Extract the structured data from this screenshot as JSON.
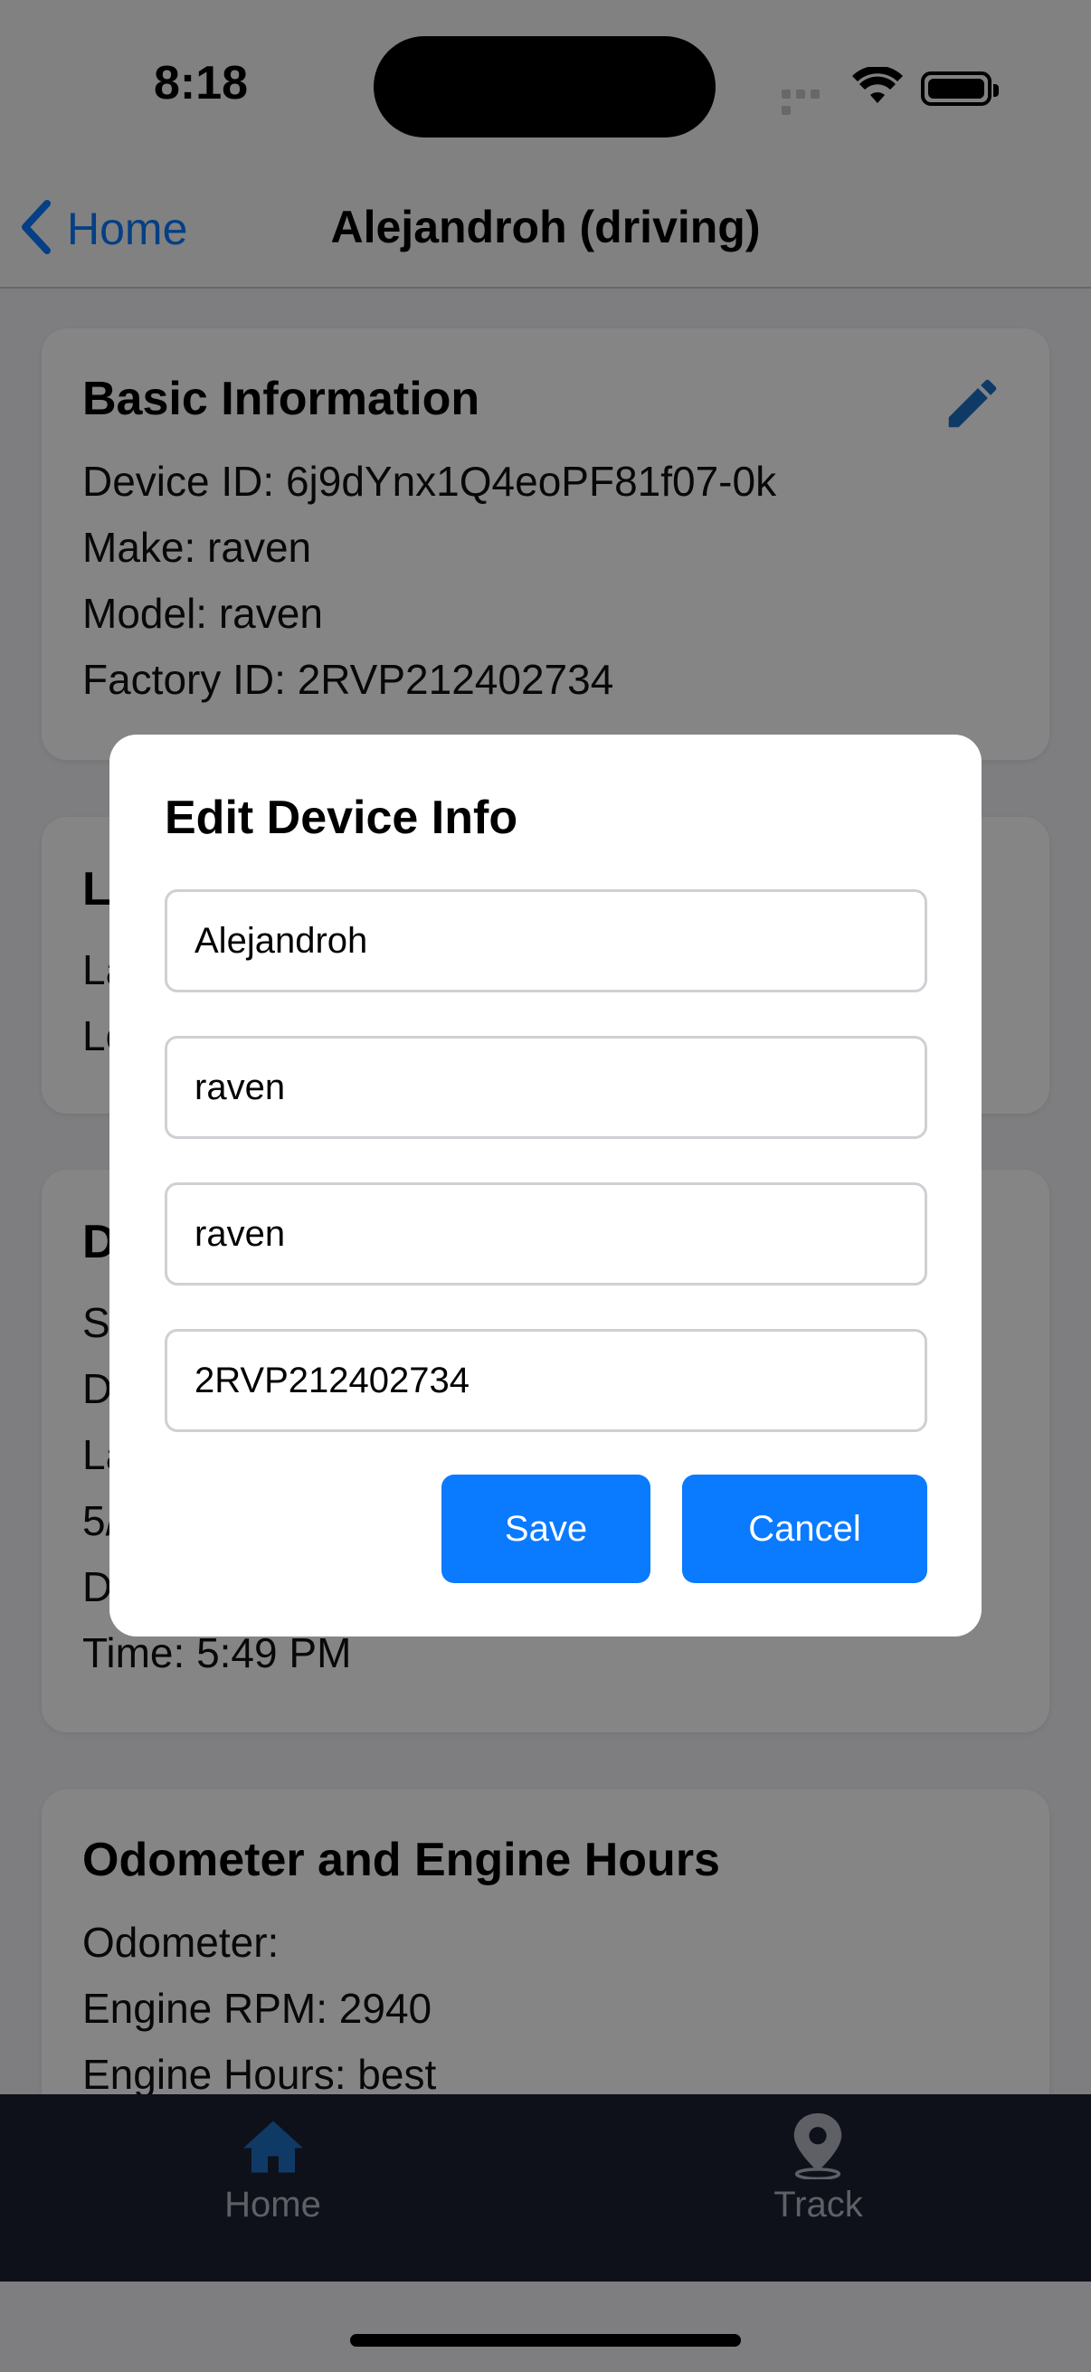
{
  "status_bar": {
    "time": "8:18"
  },
  "nav": {
    "back_label": "Home",
    "title": "Alejandroh (driving)"
  },
  "basic_info": {
    "title": "Basic Information",
    "lines": [
      "Device ID: 6j9dYnx1Q4eoPF81f07-0k",
      "Make: raven",
      "Model: raven",
      "Factory ID: 2RVP212402734"
    ]
  },
  "location_card": {
    "title": "L",
    "lines": [
      "La",
      "Lo"
    ]
  },
  "details_card": {
    "title": "D",
    "lines": [
      "S",
      "D",
      "La",
      "5/",
      "D",
      "Time: 5:49 PM"
    ]
  },
  "odometer_card": {
    "title": "Odometer and Engine Hours",
    "lines": [
      "Odometer:",
      "Engine RPM: 2940",
      "Engine Hours: best"
    ]
  },
  "modal": {
    "title": "Edit Device Info",
    "fields": [
      {
        "value": "Alejandroh"
      },
      {
        "value": "raven"
      },
      {
        "value": "raven"
      },
      {
        "value": "2RVP212402734"
      }
    ],
    "save_label": "Save",
    "cancel_label": "Cancel"
  },
  "tabs": [
    {
      "label": "Home",
      "icon": "home-icon",
      "active": true
    },
    {
      "label": "Track",
      "icon": "location-pin-icon",
      "active": false
    }
  ],
  "colors": {
    "accent": "#0a7aff",
    "tabbar": "#1b2133",
    "tab_active": "#1f6fc4"
  }
}
